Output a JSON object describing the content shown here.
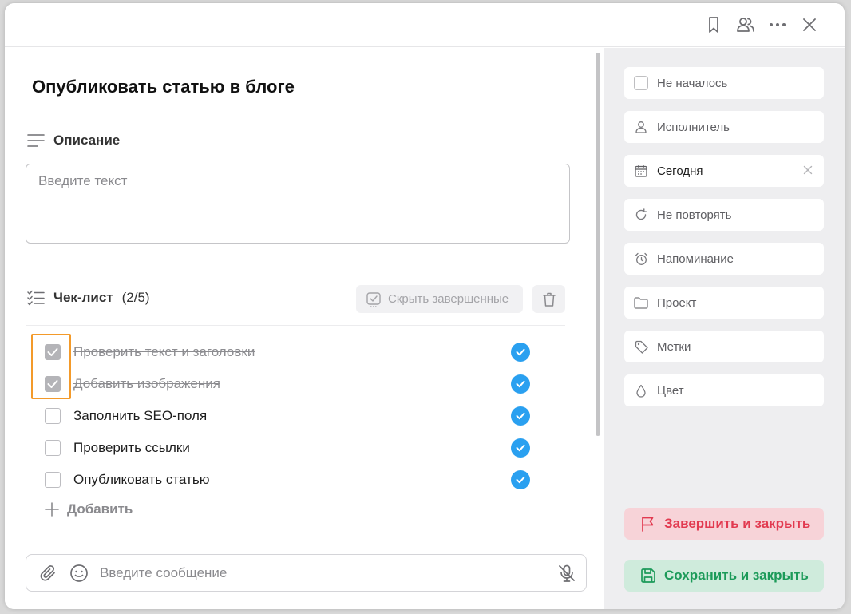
{
  "task": {
    "title": "Опубликовать статью в блоге"
  },
  "description": {
    "heading": "Описание",
    "placeholder": "Введите текст"
  },
  "checklist": {
    "heading": "Чек-лист",
    "count": "(2/5)",
    "hide_completed_label": "Скрыть завершенные",
    "add_label": "Добавить",
    "items": [
      {
        "text": "Проверить текст и заголовки",
        "checked": true
      },
      {
        "text": "Добавить изображения",
        "checked": true
      },
      {
        "text": "Заполнить SEO-поля",
        "checked": false
      },
      {
        "text": "Проверить ссылки",
        "checked": false
      },
      {
        "text": "Опубликовать статью",
        "checked": false
      }
    ]
  },
  "message": {
    "placeholder": "Введите сообщение"
  },
  "sidebar": {
    "status": "Не началось",
    "assignee": "Исполнитель",
    "date": "Сегодня",
    "repeat": "Не повторять",
    "reminder": "Напоминание",
    "project": "Проект",
    "tags": "Метки",
    "color": "Цвет",
    "complete_label": "Завершить и закрыть",
    "save_label": "Сохранить и закрыть"
  },
  "icons": {
    "topbar": [
      "bookmark-icon",
      "users-icon",
      "more-icon",
      "close-icon"
    ],
    "sidebar": [
      "checkbox-icon",
      "user-icon",
      "calendar-icon",
      "repeat-icon",
      "alarm-icon",
      "folder-icon",
      "tag-icon",
      "drop-icon"
    ],
    "message_bar": [
      "paperclip-icon",
      "smile-icon",
      "mic-off-icon"
    ]
  },
  "colors": {
    "accent_blue": "#2aa0f0",
    "highlight_orange": "#f39a2a",
    "complete_bg": "#f7d3d8",
    "complete_text": "#e23a50",
    "save_bg": "#cfebdc",
    "save_text": "#1c9a59",
    "sidebar_bg": "#eeeef0"
  }
}
